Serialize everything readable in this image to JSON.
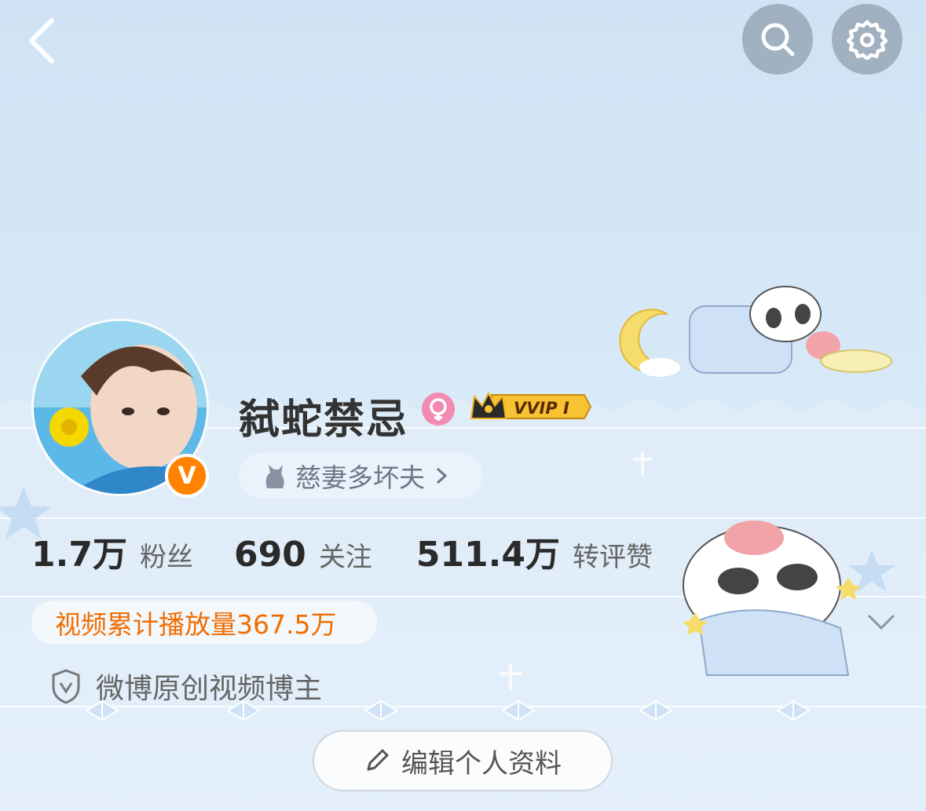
{
  "profile": {
    "name": "弑蛇禁忌",
    "verified_badge": "V",
    "vip_label": "VVIP Ⅰ",
    "tag": "慈妻多坏夫"
  },
  "stats": [
    {
      "value": "1.7万",
      "label": "粉丝"
    },
    {
      "value": "690",
      "label": "关注"
    },
    {
      "value": "511.4万",
      "label": "转评赞"
    }
  ],
  "video_plays": "视频累计播放量367.5万",
  "creator_badge": "微博原创视频博主",
  "edit_button": "编辑个人资料",
  "icons": {
    "back": "back-arrow-icon",
    "search": "search-icon",
    "settings": "gear-icon",
    "gender": "female-icon",
    "expand": "chevron-down-icon",
    "shield": "shield-icon",
    "edit": "pencil-icon",
    "cat": "cat-icon"
  },
  "colors": {
    "accent_orange": "#ff8200",
    "plays_text": "#f26d00",
    "gender_pink": "#f28ab2",
    "background": "#d6e8f7"
  }
}
